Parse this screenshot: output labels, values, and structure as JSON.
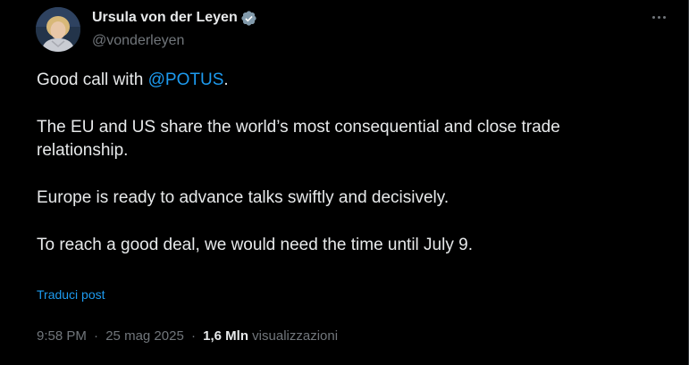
{
  "author": {
    "display_name": "Ursula von der Leyen",
    "handle": "@vonderleyen",
    "verified_icon": "verified-badge-icon",
    "avatar_icon": "avatar"
  },
  "menu": {
    "more_icon": "more-options-icon"
  },
  "tweet": {
    "line1_prefix": "Good call with ",
    "line1_mention": "@POTUS",
    "line1_suffix": ".",
    "para2_line1": "The EU and US share the world’s most consequential and close trade",
    "para2_line2": "relationship.",
    "para3": "Europe is ready to advance talks swiftly and decisively.",
    "para4": "To reach a good deal, we would need the time until July 9."
  },
  "translate_label": "Traduci post",
  "meta": {
    "time": "9:58 PM",
    "separator": "·",
    "date": "25 mag 2025",
    "views_count": "1,6 Mln",
    "views_label": "visualizzazioni"
  },
  "colors": {
    "background": "#000000",
    "text": "#e7e9ea",
    "secondary": "#71767b",
    "accent": "#1d9bf0"
  }
}
